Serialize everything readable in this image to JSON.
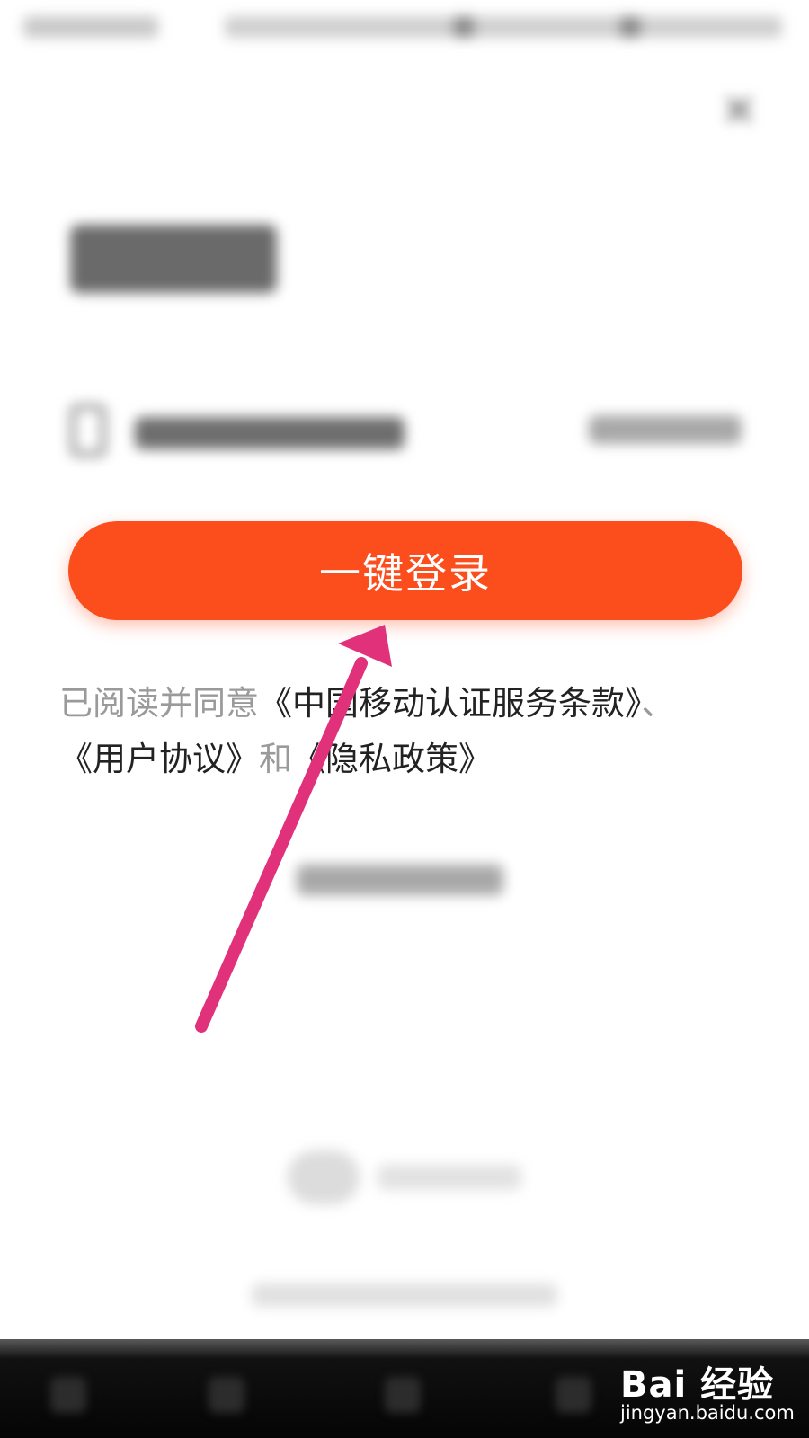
{
  "login": {
    "button_label": "一键登录"
  },
  "agreement": {
    "prefix": "已阅读并同意",
    "terms_link": "《中国移动认证服务条款》",
    "separator": "、",
    "user_agreement_link": "《用户协议》",
    "conjunction": "和",
    "privacy_policy_link": "《隐私政策》"
  },
  "watermark": {
    "logo": "Bai 经验",
    "url": "jingyan.baidu.com"
  },
  "colors": {
    "primary_button": "#fc4d1d",
    "annotation_arrow": "#e0317a"
  }
}
